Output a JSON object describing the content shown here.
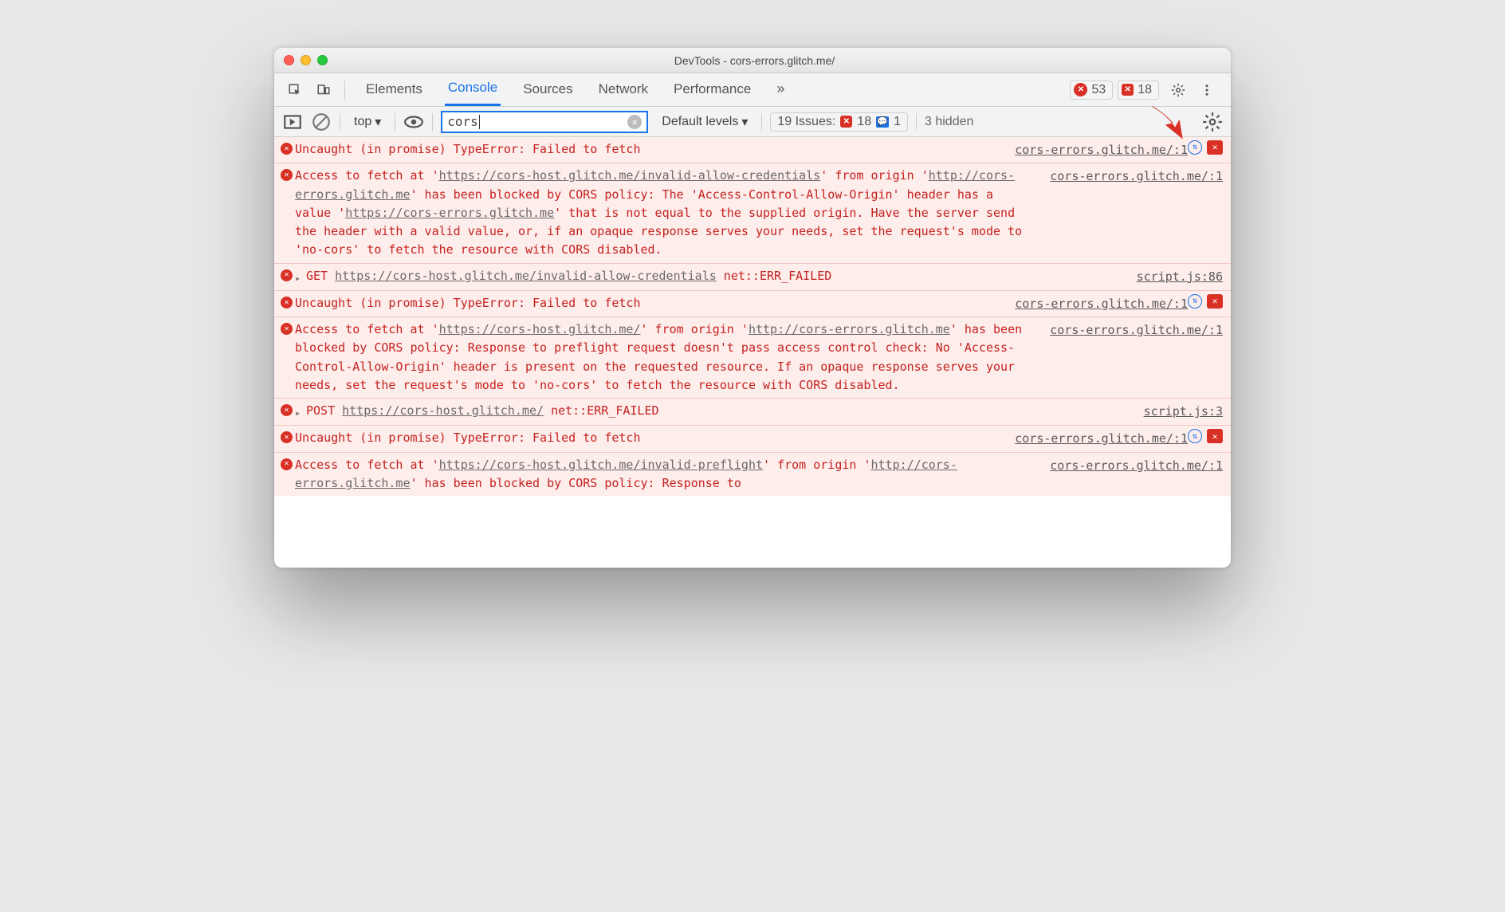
{
  "window": {
    "title": "DevTools - cors-errors.glitch.me/"
  },
  "tabstrip": {
    "tabs": [
      "Elements",
      "Console",
      "Sources",
      "Network",
      "Performance"
    ],
    "active_index": 1,
    "more": "»",
    "errors": "53",
    "issues": "18"
  },
  "filter": {
    "context": "top",
    "input": "cors",
    "levels": "Default levels",
    "issues_label": "19 Issues:",
    "issues_errors": "18",
    "issues_info": "1",
    "hidden": "3 hidden"
  },
  "messages": [
    {
      "kind": "uncaught",
      "text": "Uncaught (in promise) TypeError: Failed to fetch",
      "src": "cors-errors.glitch.me/:1",
      "icons": true
    },
    {
      "kind": "cors-long",
      "pre": "Access to fetch at '",
      "url1": "https://cors-host.glitch.me/invalid-allow-credentials",
      "mid": "' from origin '",
      "url2": "http://cors-errors.glitch.me",
      "post": "' has been blocked by CORS policy: The 'Access-Control-Allow-Origin' header has a value '",
      "url3": "https://cors-errors.glitch.me",
      "tail": "' that is not equal to the supplied origin. Have the server send the header with a valid value, or, if an opaque response serves your needs, set the request's mode to 'no-cors' to fetch the resource with CORS disabled.",
      "src": "cors-errors.glitch.me/:1"
    },
    {
      "kind": "net",
      "method": "GET",
      "url": "https://cors-host.glitch.me/invalid-allow-credentials",
      "err": "net::ERR_FAILED",
      "src": "script.js:86"
    },
    {
      "kind": "uncaught",
      "text": "Uncaught (in promise) TypeError: Failed to fetch",
      "src": "cors-errors.glitch.me/:1",
      "icons": true
    },
    {
      "kind": "cors-long2",
      "pre": "Access to fetch at '",
      "url1": "https://cors-host.glitch.me/",
      "mid": "' from origin '",
      "url2": "http://cors-errors.glitch.me",
      "post": "' has been blocked by CORS policy: Response to preflight request doesn't pass access control check: No 'Access-Control-Allow-Origin' header is present on the requested resource. If an opaque response serves your needs, set the request's mode to 'no-cors' to fetch the resource with CORS disabled.",
      "src": "cors-errors.glitch.me/:1"
    },
    {
      "kind": "net",
      "method": "POST",
      "url": "https://cors-host.glitch.me/",
      "err": "net::ERR_FAILED",
      "src": "script.js:3"
    },
    {
      "kind": "uncaught",
      "text": "Uncaught (in promise) TypeError: Failed to fetch",
      "src": "cors-errors.glitch.me/:1",
      "icons": true
    },
    {
      "kind": "cors-cut",
      "pre": "Access to fetch at '",
      "url1": "https://cors-host.glitch.me/invalid-preflight",
      "mid": "' from origin '",
      "url2": "http://cors-errors.glitch.me",
      "post": "' has been blocked by CORS policy: Response to",
      "src": "cors-errors.glitch.me/:1"
    }
  ]
}
